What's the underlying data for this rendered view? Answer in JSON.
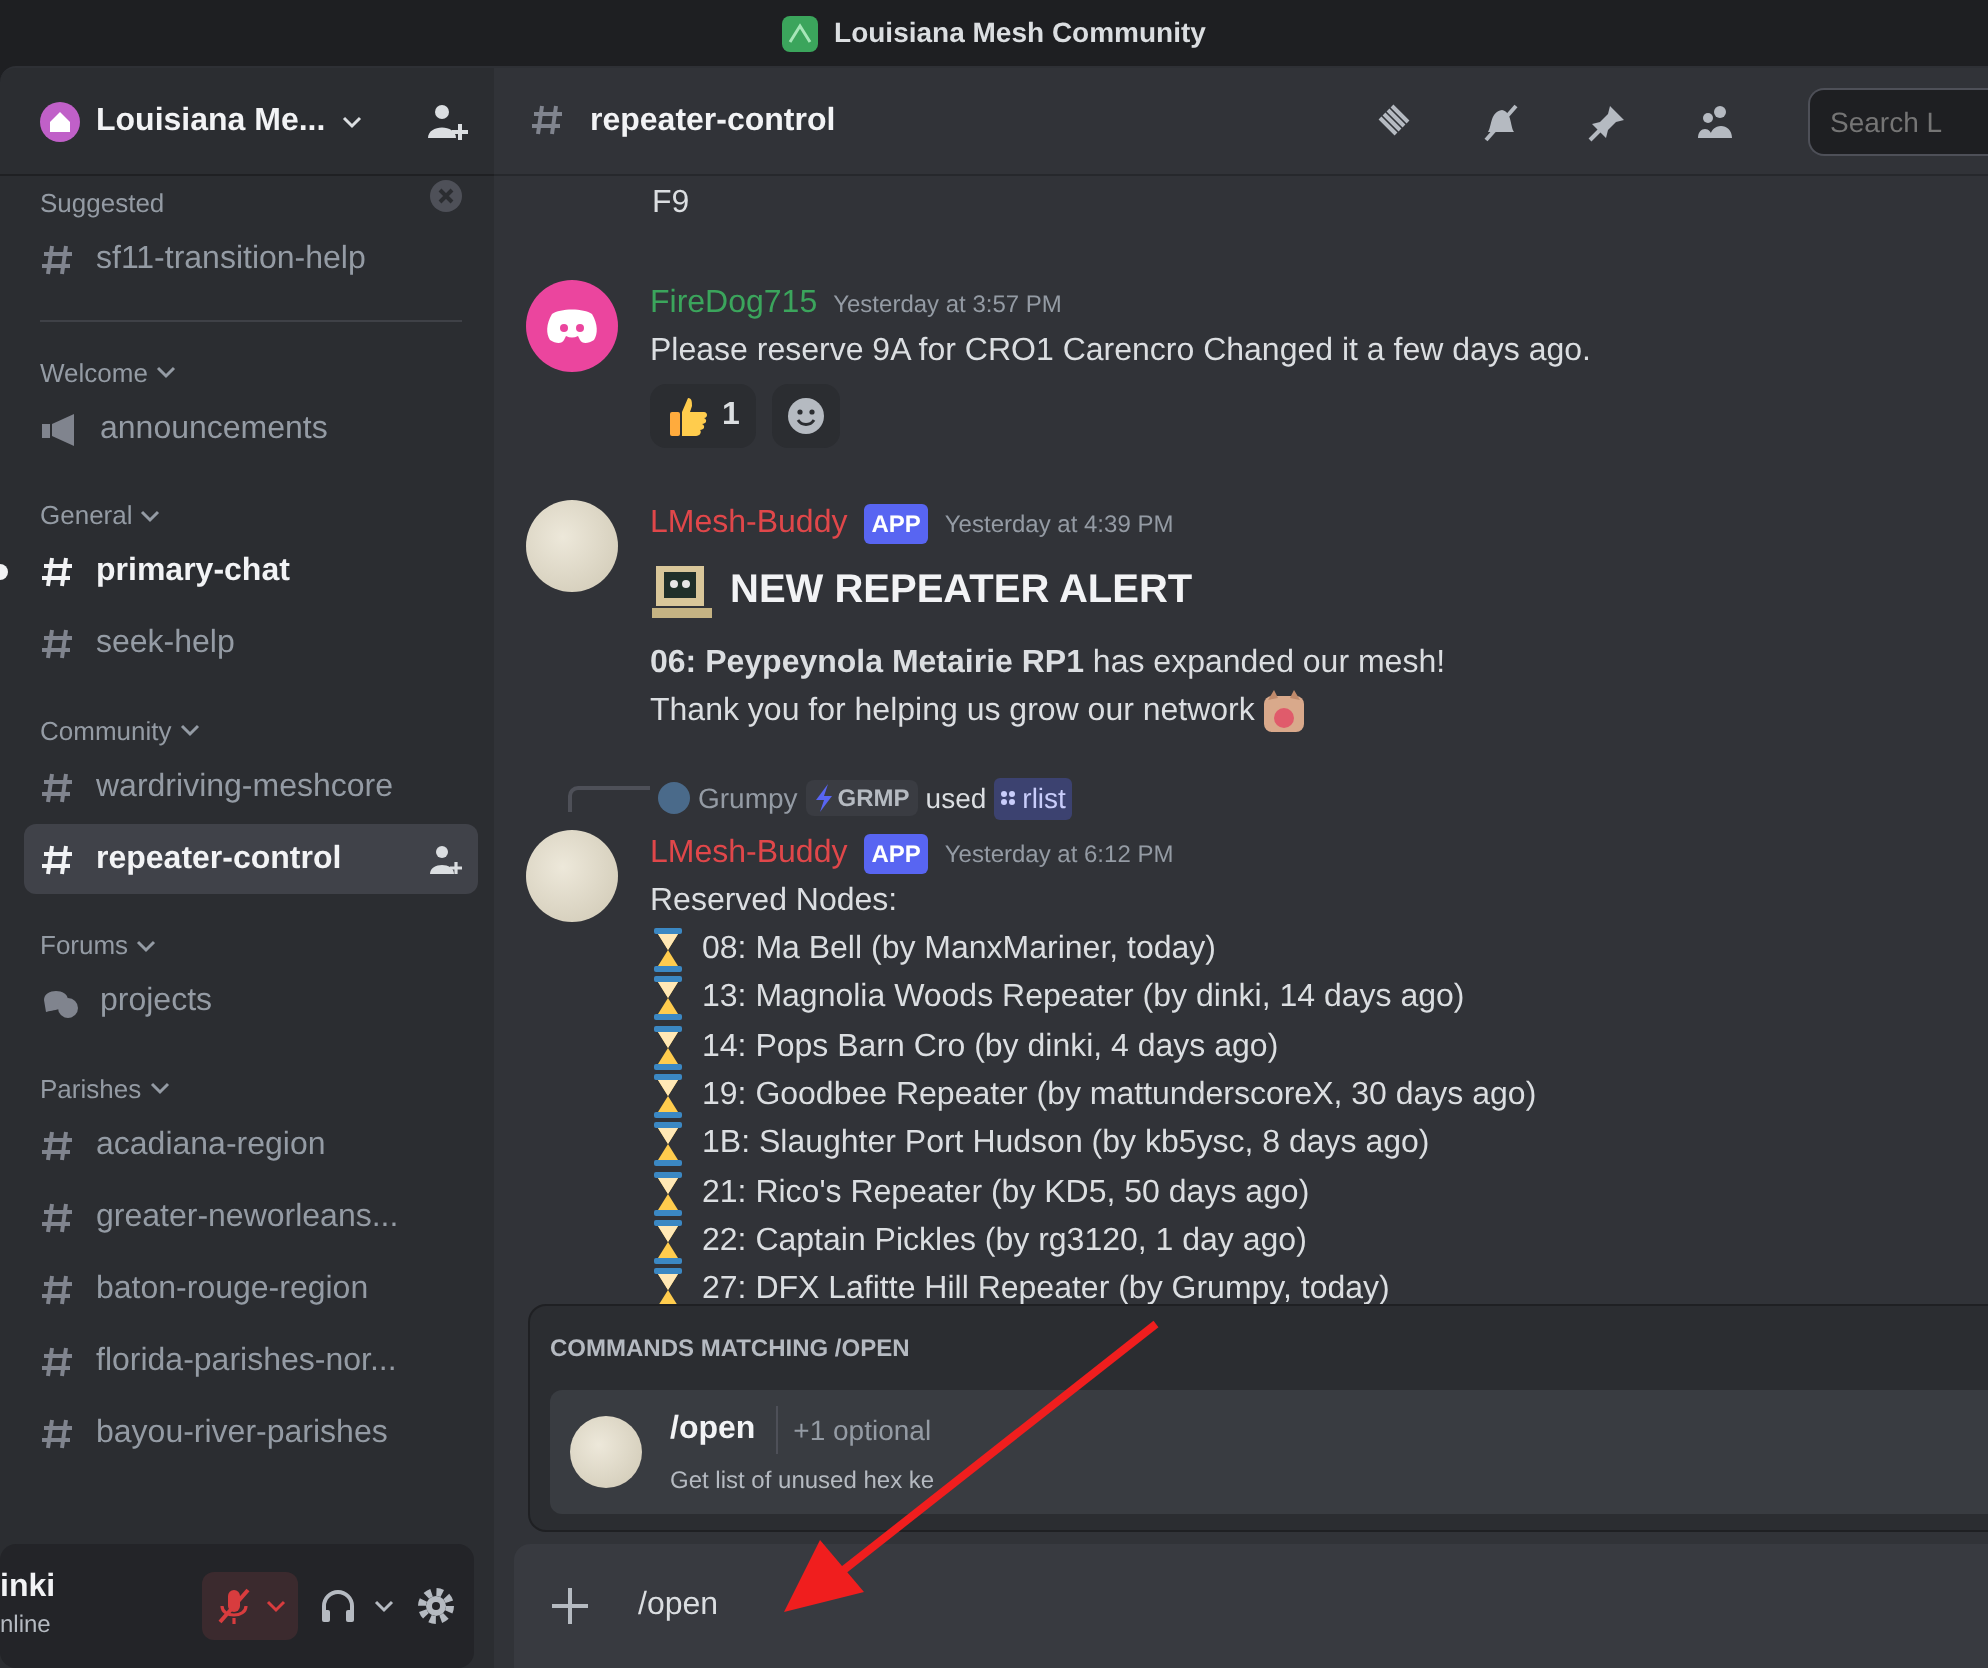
{
  "window": {
    "title": "Louisiana Mesh Community"
  },
  "server": {
    "name": "Louisiana Me..."
  },
  "sidebar": {
    "groups": [
      {
        "label": "Suggested",
        "kind": "suggested",
        "channels": [
          {
            "name": "sf11-transition-help",
            "kind": "text",
            "selected": false,
            "unread": false
          }
        ]
      },
      {
        "label": "Welcome",
        "kind": "category",
        "channels": [
          {
            "name": "announcements",
            "kind": "announcement",
            "selected": false,
            "unread": false
          }
        ]
      },
      {
        "label": "General",
        "kind": "category",
        "channels": [
          {
            "name": "primary-chat",
            "kind": "text",
            "selected": false,
            "unread": true
          },
          {
            "name": "seek-help",
            "kind": "text",
            "selected": false,
            "unread": false
          }
        ]
      },
      {
        "label": "Community",
        "kind": "category",
        "channels": [
          {
            "name": "wardriving-meshcore",
            "kind": "text",
            "selected": false,
            "unread": false
          },
          {
            "name": "repeater-control",
            "kind": "text",
            "selected": true,
            "unread": false
          }
        ]
      },
      {
        "label": "Forums",
        "kind": "category",
        "channels": [
          {
            "name": "projects",
            "kind": "forum",
            "selected": false,
            "unread": false
          }
        ]
      },
      {
        "label": "Parishes",
        "kind": "category",
        "channels": [
          {
            "name": "acadiana-region",
            "kind": "text",
            "selected": false,
            "unread": false
          },
          {
            "name": "greater-neworleans...",
            "kind": "text",
            "selected": false,
            "unread": false
          },
          {
            "name": "baton-rouge-region",
            "kind": "text",
            "selected": false,
            "unread": false
          },
          {
            "name": "florida-parishes-nor...",
            "kind": "text",
            "selected": false,
            "unread": false
          },
          {
            "name": "bayou-river-parishes",
            "kind": "text",
            "selected": false,
            "unread": false
          }
        ]
      }
    ]
  },
  "user_panel": {
    "name": "inki",
    "status": "nline",
    "mic_muted": true
  },
  "channel_header": {
    "name": "repeater-control",
    "search_placeholder": "Search L"
  },
  "messages": [
    {
      "kind": "continuation",
      "lines": [
        "F9"
      ]
    },
    {
      "kind": "message",
      "author": "FireDog715",
      "color": "#3ba55c",
      "avatar": {
        "kind": "discord"
      },
      "time": "Yesterday at 3:57 PM",
      "lines": [
        "Please reserve 9A for CRO1 Carencro Changed it a few days ago."
      ],
      "reactions": [
        {
          "count": "1"
        }
      ]
    },
    {
      "kind": "message",
      "author": "LMesh-Buddy",
      "color": "#e0474a",
      "avatar": {
        "kind": "photo"
      },
      "badge": "APP",
      "time": "Yesterday at 4:39 PM",
      "heading": "NEW REPEATER ALERT",
      "lines": [
        "**06: Peypeynola Metairie RP1** has expanded our mesh!",
        "Thank you for helping us grow our network"
      ]
    },
    {
      "kind": "message",
      "author": "LMesh-Buddy",
      "color": "#e0474a",
      "avatar": {
        "kind": "photo"
      },
      "badge": "APP",
      "time": "Yesterday at 6:12 PM",
      "reply": {
        "user": "Grumpy",
        "tag": "GRMP",
        "verb": "used",
        "command": "rlist"
      },
      "lines": [
        "Reserved Nodes:"
      ],
      "items": [
        "08: Ma Bell (by ManxMariner, today)",
        "13: Magnolia Woods Repeater (by dinki, 14 days ago)",
        "14: Pops Barn Cro (by dinki, 4 days ago)",
        "19: Goodbee Repeater (by mattunderscoreX, 30 days ago)",
        "1B: Slaughter Port Hudson (by kb5ysc, 8 days ago)",
        "21: Rico's Repeater (by KD5, 50 days ago)",
        "22: Captain Pickles (by rg3120, 1 day ago)",
        "27: DFX Lafitte Hill Repeater (by Grumpy, today)"
      ]
    }
  ],
  "command_popup": {
    "title": "COMMANDS MATCHING /OPEN",
    "commands": [
      {
        "name": "/open",
        "options": "+1 optional",
        "description": "Get list of unused hex ke",
        "selected": true
      }
    ]
  },
  "composer": {
    "value": "/open"
  }
}
